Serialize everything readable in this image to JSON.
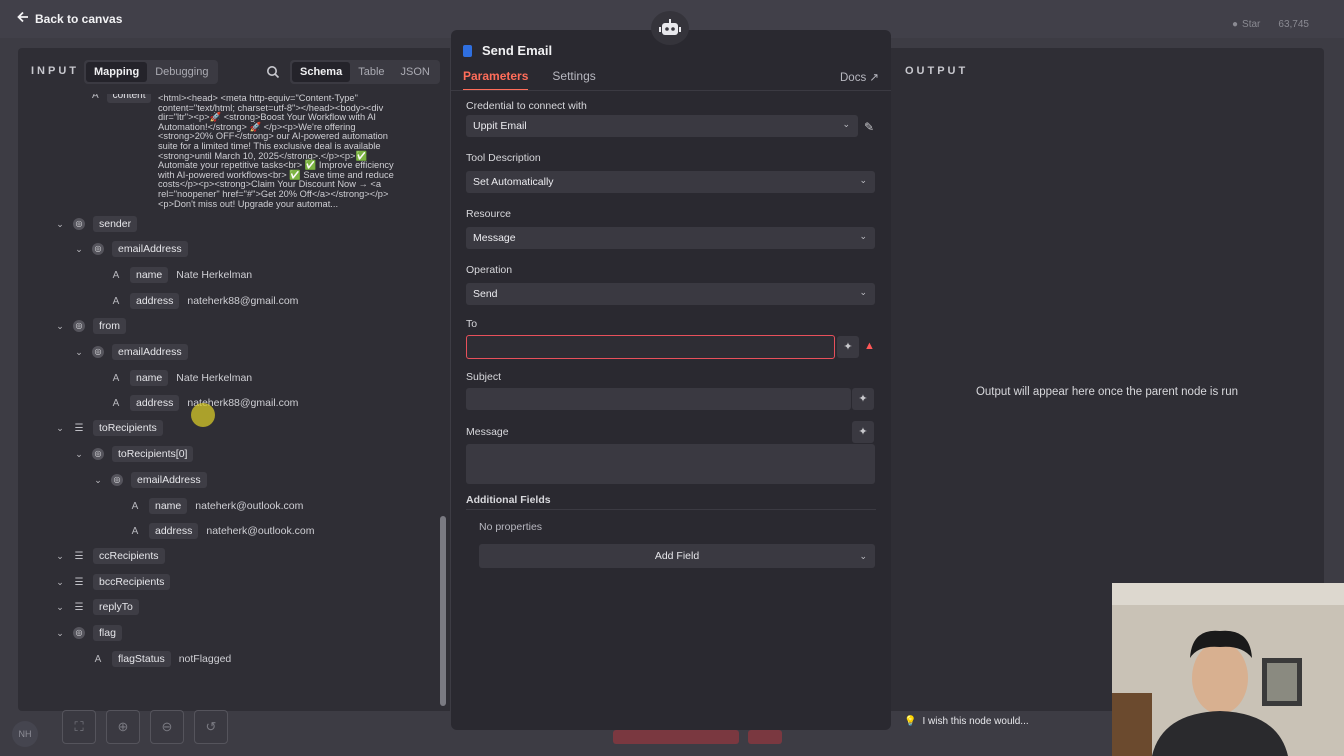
{
  "topbar": {
    "back_label": "Back to canvas",
    "star_label": "Star",
    "star_count": "63,745"
  },
  "input": {
    "title": "INPUT",
    "mode_tabs": [
      "Mapping",
      "Debugging"
    ],
    "view_tabs": [
      "Schema",
      "Table",
      "JSON"
    ],
    "content_key": "content",
    "content_lines": [
      "<html><head> <meta http-equiv=\"Content-Type\"",
      "content=\"text/html; charset=utf-8\"></head><body><div",
      "dir=\"ltr\"><p>🚀 <strong>Boost Your Workflow with AI",
      "Automation!</strong> 🚀 </p><p>We're offering",
      "<strong>20% OFF</strong> our AI-powered automation",
      "suite for a limited time! This exclusive deal is available",
      "<strong>until March 10, 2025</strong>.</p><p>✅",
      "Automate your repetitive tasks<br> ✅ Improve efficiency",
      "with AI-powered workflows<br> ✅ Save time and reduce",
      "costs</p><p><strong>Claim Your Discount Now → <a",
      "rel=\"noopener\" href=\"#\">Get 20% Off</a></strong></p>",
      "<p>Don't miss out! Upgrade your automat..."
    ],
    "tree": {
      "sender": "sender",
      "sender_emailAddress": "emailAddress",
      "sender_name_key": "name",
      "sender_name_val": "Nate Herkelman",
      "sender_address_key": "address",
      "sender_address_val": "nateherk88@gmail.com",
      "from": "from",
      "from_emailAddress": "emailAddress",
      "from_name_key": "name",
      "from_name_val": "Nate Herkelman",
      "from_address_key": "address",
      "from_address_val": "nateherk88@gmail.com",
      "toRecipients": "toRecipients",
      "toRecipients0": "toRecipients[0]",
      "to_emailAddress": "emailAddress",
      "to_name_key": "name",
      "to_name_val": "nateherk@outlook.com",
      "to_address_key": "address",
      "to_address_val": "nateherk@outlook.com",
      "ccRecipients": "ccRecipients",
      "bccRecipients": "bccRecipients",
      "replyTo": "replyTo",
      "flag": "flag",
      "flagStatus_key": "flagStatus",
      "flagStatus_val": "notFlagged"
    }
  },
  "node": {
    "title": "Send Email",
    "tabs": [
      "Parameters",
      "Settings"
    ],
    "docs": "Docs",
    "credential_label": "Credential to connect with",
    "credential_value": "Uppit Email",
    "tool_desc_label": "Tool Description",
    "tool_desc_value": "Set Automatically",
    "resource_label": "Resource",
    "resource_value": "Message",
    "operation_label": "Operation",
    "operation_value": "Send",
    "to_label": "To",
    "to_value": "",
    "subject_label": "Subject",
    "subject_value": "",
    "message_label": "Message",
    "message_value": "",
    "additional_label": "Additional Fields",
    "no_props": "No properties",
    "add_field": "Add Field"
  },
  "output": {
    "title": "OUTPUT",
    "message": "Output will appear here once the parent node is run"
  },
  "footer": {
    "wish": "I wish this node would...",
    "avatar": "NH"
  }
}
